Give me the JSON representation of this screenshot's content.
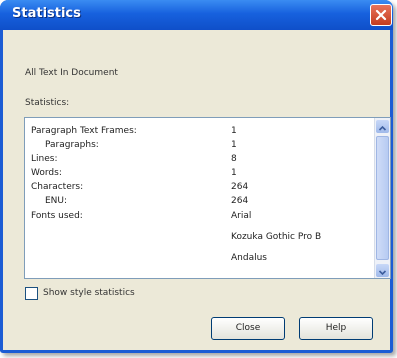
{
  "dialog": {
    "title": "Statistics",
    "subtitle": "All Text In Document",
    "stats_label": "Statistics:",
    "accent": "#1c5cd4"
  },
  "stats": [
    {
      "label": "Paragraph Text Frames:",
      "value": "1",
      "indent": false
    },
    {
      "label": "Paragraphs:",
      "value": "1",
      "indent": true
    },
    {
      "label": "Lines:",
      "value": "8",
      "indent": false
    },
    {
      "label": "Words:",
      "value": "1",
      "indent": false
    },
    {
      "label": "Characters:",
      "value": "264",
      "indent": false
    },
    {
      "label": "ENU:",
      "value": "264",
      "indent": true
    },
    {
      "label": "Fonts used:",
      "value": "Arial",
      "indent": false
    },
    {
      "label": "",
      "value": "Kozuka Gothic Pro B",
      "indent": false
    },
    {
      "label": "",
      "value": "Andalus",
      "indent": false
    }
  ],
  "options": {
    "show_style_statistics": "Show style statistics",
    "checked": false
  },
  "buttons": {
    "close": "Close",
    "help": "Help"
  },
  "icons": {
    "close": "close-icon",
    "scroll_up": "chevron-up-icon",
    "scroll_down": "chevron-down-icon"
  }
}
